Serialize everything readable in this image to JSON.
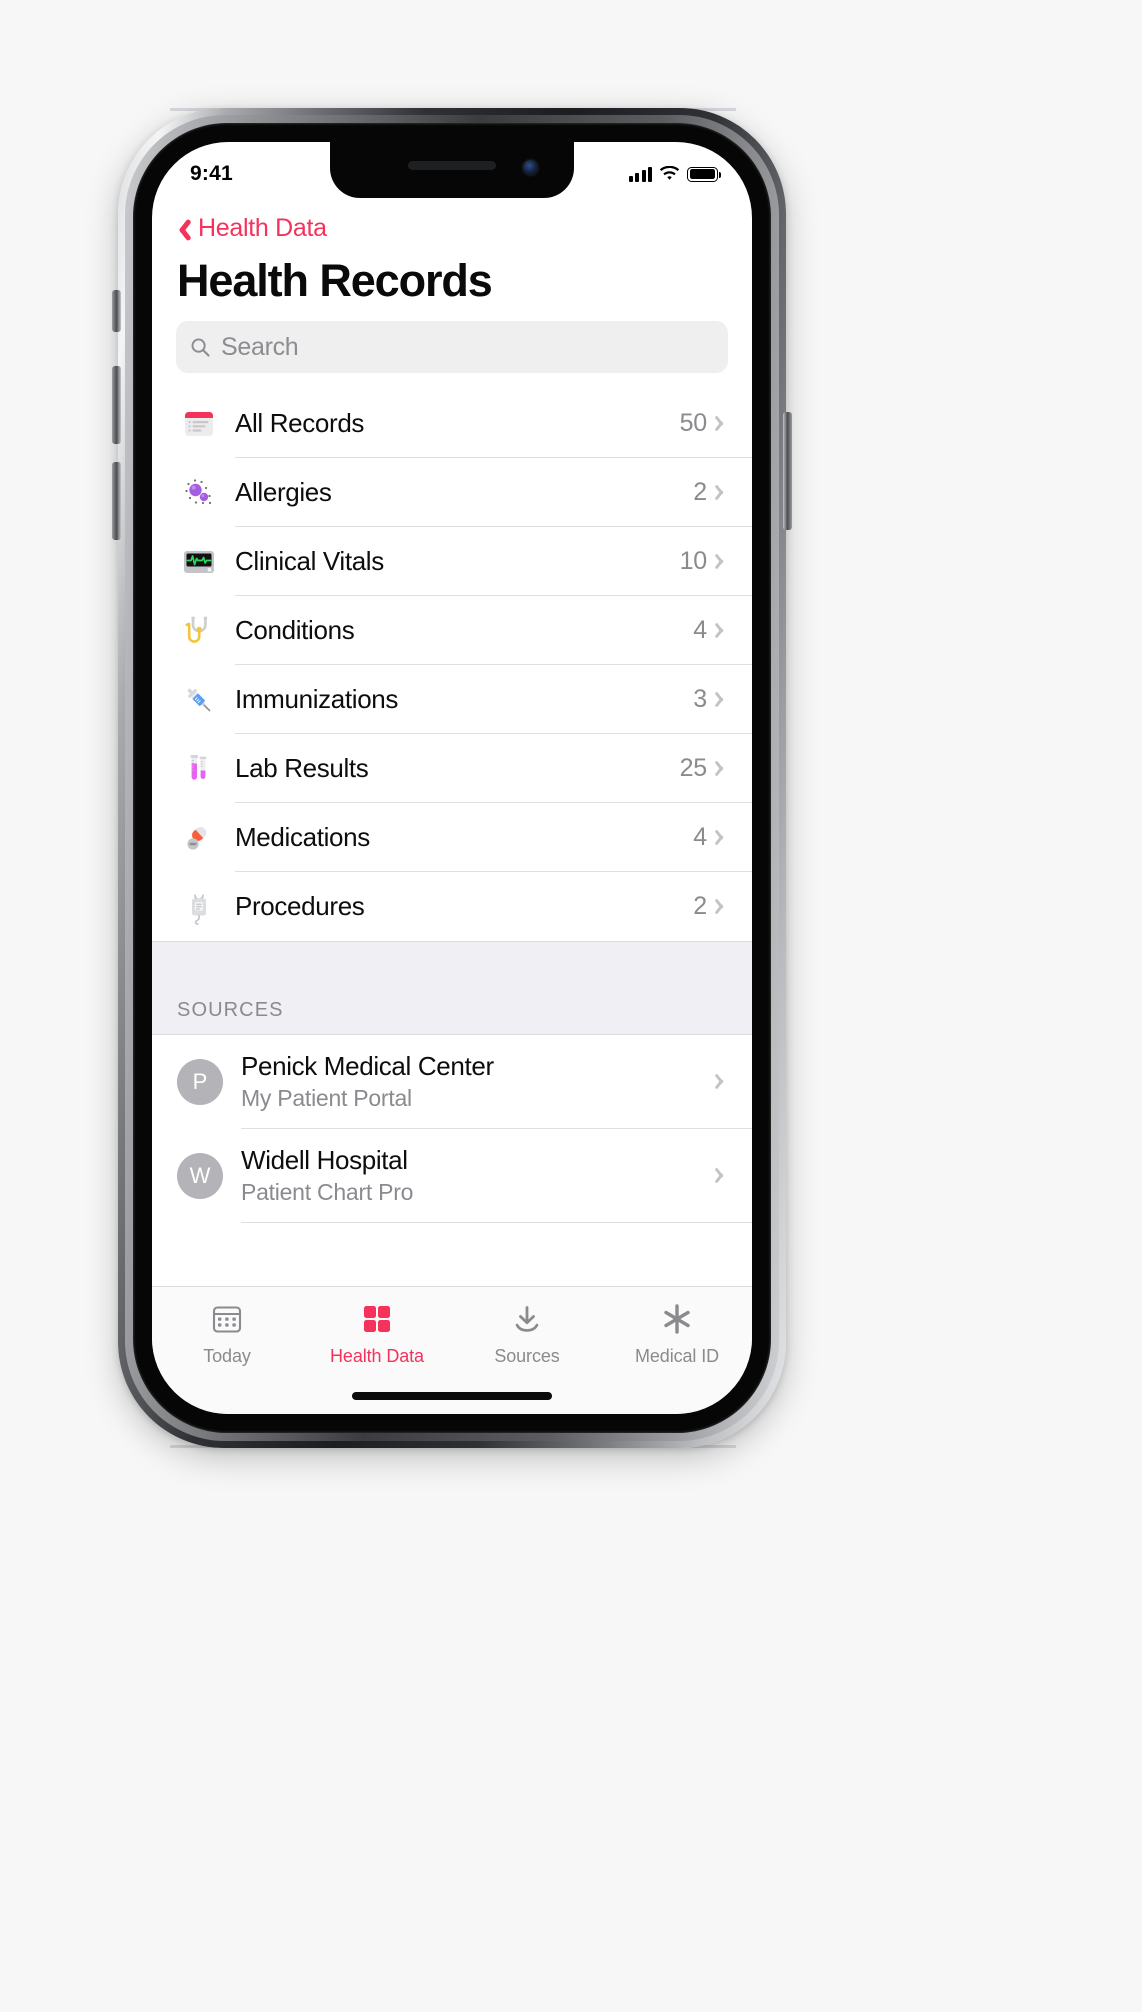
{
  "status_bar": {
    "time": "9:41",
    "signal_icon": "cellular-bars-icon",
    "wifi_icon": "wifi-icon",
    "battery_icon": "battery-full-icon"
  },
  "nav": {
    "back_label": "Health Data",
    "back_icon": "chevron-left-icon",
    "accent_color": "#f5325c"
  },
  "header": {
    "title": "Health Records"
  },
  "search": {
    "placeholder": "Search",
    "icon": "search-icon",
    "value": ""
  },
  "records": {
    "rows": [
      {
        "label": "All Records",
        "count": "50",
        "icon": "records-document-icon",
        "accent": "#f5325c"
      },
      {
        "label": "Allergies",
        "count": "2",
        "icon": "allergen-pollen-icon",
        "accent": "#9d5bd2"
      },
      {
        "label": "Clinical Vitals",
        "count": "10",
        "icon": "vitals-monitor-icon",
        "accent": "#2fd85c"
      },
      {
        "label": "Conditions",
        "count": "4",
        "icon": "stethoscope-icon",
        "accent": "#f2c53d"
      },
      {
        "label": "Immunizations",
        "count": "3",
        "icon": "syringe-icon",
        "accent": "#5a9ef5"
      },
      {
        "label": "Lab Results",
        "count": "25",
        "icon": "test-tubes-icon",
        "accent": "#e966f0"
      },
      {
        "label": "Medications",
        "count": "4",
        "icon": "pill-capsule-icon",
        "accent": "#fc5c38"
      },
      {
        "label": "Procedures",
        "count": "2",
        "icon": "iv-drip-icon",
        "accent": "#c9c9ce"
      }
    ],
    "disclosure_icon": "chevron-right-icon"
  },
  "sources": {
    "section_title": "SOURCES",
    "items": [
      {
        "initial": "P",
        "name": "Penick Medical Center",
        "subtitle": "My Patient Portal"
      },
      {
        "initial": "W",
        "name": "Widell Hospital",
        "subtitle": "Patient Chart Pro"
      }
    ],
    "disclosure_icon": "chevron-right-icon"
  },
  "tab_bar": {
    "tabs": [
      {
        "label": "Today",
        "icon": "calendar-icon",
        "active": false
      },
      {
        "label": "Health Data",
        "icon": "health-grid-icon",
        "active": true
      },
      {
        "label": "Sources",
        "icon": "download-arrow-icon",
        "active": false
      },
      {
        "label": "Medical ID",
        "icon": "asterisk-medical-icon",
        "active": false
      }
    ],
    "active_color": "#f5325c",
    "inactive_color": "#8a8a8f"
  }
}
